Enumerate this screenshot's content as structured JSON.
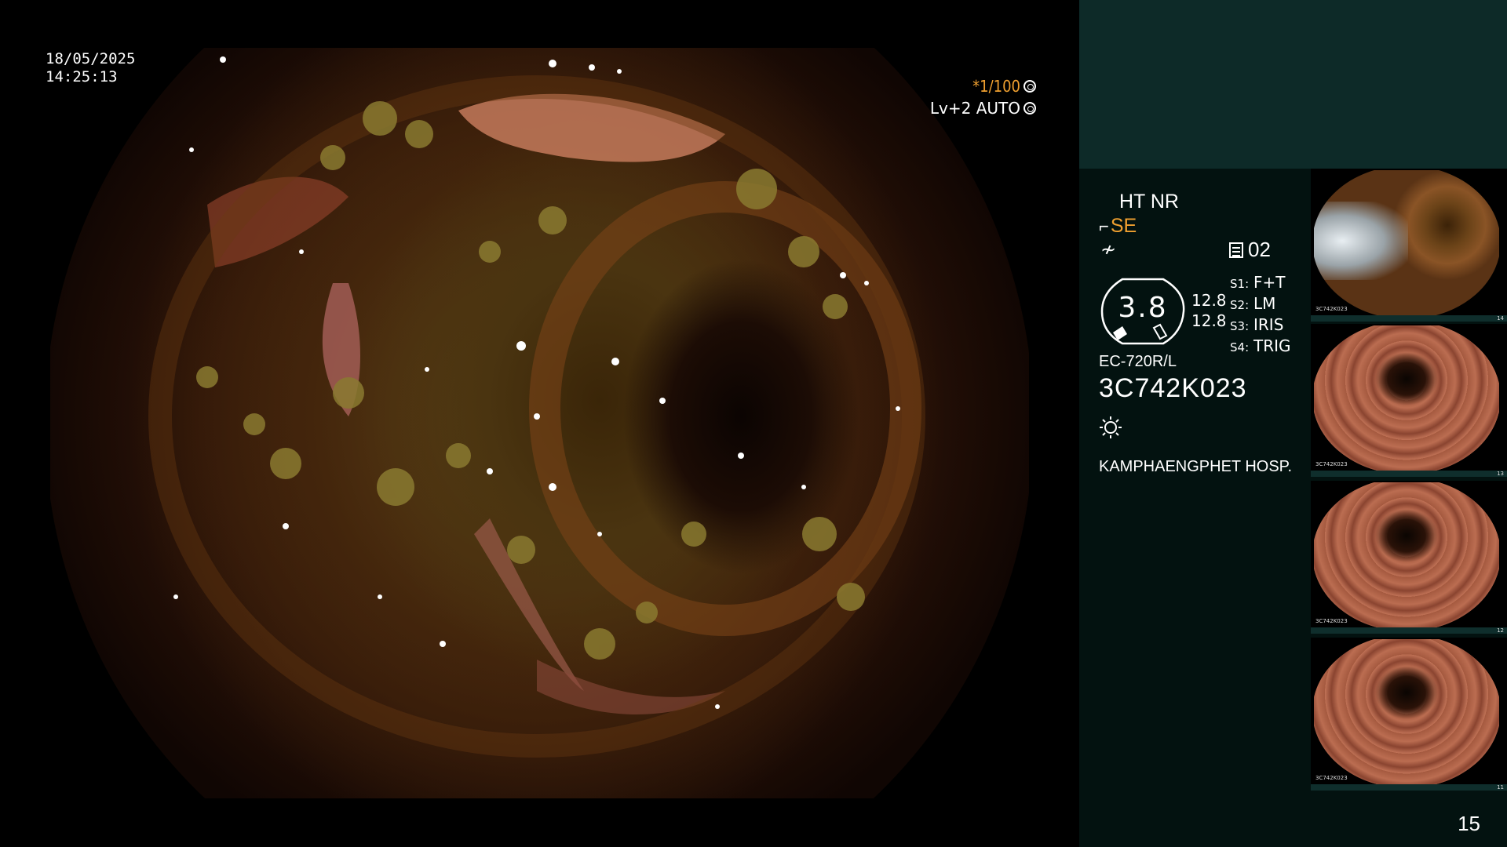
{
  "overlay": {
    "date": "18/05/2025",
    "time": "14:25:13",
    "shutter": "*1/100",
    "iris": "Lv+2 AUTO"
  },
  "panel": {
    "mode_line": "HT NR",
    "structure_enhancement": "SE",
    "memory_label": "02",
    "gauge_value": "3.8",
    "gauge_nums": [
      "12.8",
      "12.8"
    ],
    "switches": [
      {
        "key": "S1:",
        "value": "F+T"
      },
      {
        "key": "S2:",
        "value": "LM"
      },
      {
        "key": "S3:",
        "value": "IRIS"
      },
      {
        "key": "S4:",
        "value": "TRIG"
      }
    ],
    "scope_model": "EC-720R/L",
    "scope_serial": "3C742K023",
    "hospital": "KAMPHAENGPHET HOSP."
  },
  "thumbnails": [
    {
      "serial": "3C742K023",
      "number": "14"
    },
    {
      "serial": "3C742K023",
      "number": "13"
    },
    {
      "serial": "3C742K023",
      "number": "12"
    },
    {
      "serial": "3C742K023",
      "number": "11"
    }
  ],
  "page_number": "15",
  "colors": {
    "accent_orange": "#f0a030",
    "panel_bg": "#031210",
    "panel_top_bg": "#0d2a28"
  }
}
